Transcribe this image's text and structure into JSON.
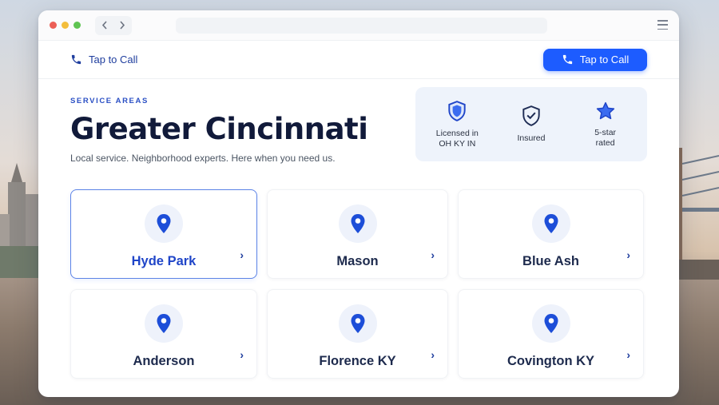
{
  "header": {
    "tap_link_label": "Tap to Call",
    "tap_button_label": "Tap to Call"
  },
  "hero": {
    "eyebrow": "SERVICE AREAS",
    "title": "Greater Cincinnati",
    "subtitle": "Local service. Neighborhood experts. Here when you need us."
  },
  "badges": [
    {
      "icon": "shield-icon",
      "line1": "Licensed in",
      "line2": "OH KY IN"
    },
    {
      "icon": "shield-check-icon",
      "line1": "Insured",
      "line2": ""
    },
    {
      "icon": "star-icon",
      "line1": "5-star",
      "line2": "rated"
    }
  ],
  "areas": [
    {
      "label": "Hyde Park",
      "selected": true
    },
    {
      "label": "Mason",
      "selected": false
    },
    {
      "label": "Blue Ash",
      "selected": false
    },
    {
      "label": "Anderson",
      "selected": false
    },
    {
      "label": "Florence KY",
      "selected": false
    },
    {
      "label": "Covington KY",
      "selected": false
    }
  ],
  "colors": {
    "accent": "#1d5cff",
    "heading": "#111a3a",
    "link": "#1f3e9e"
  }
}
